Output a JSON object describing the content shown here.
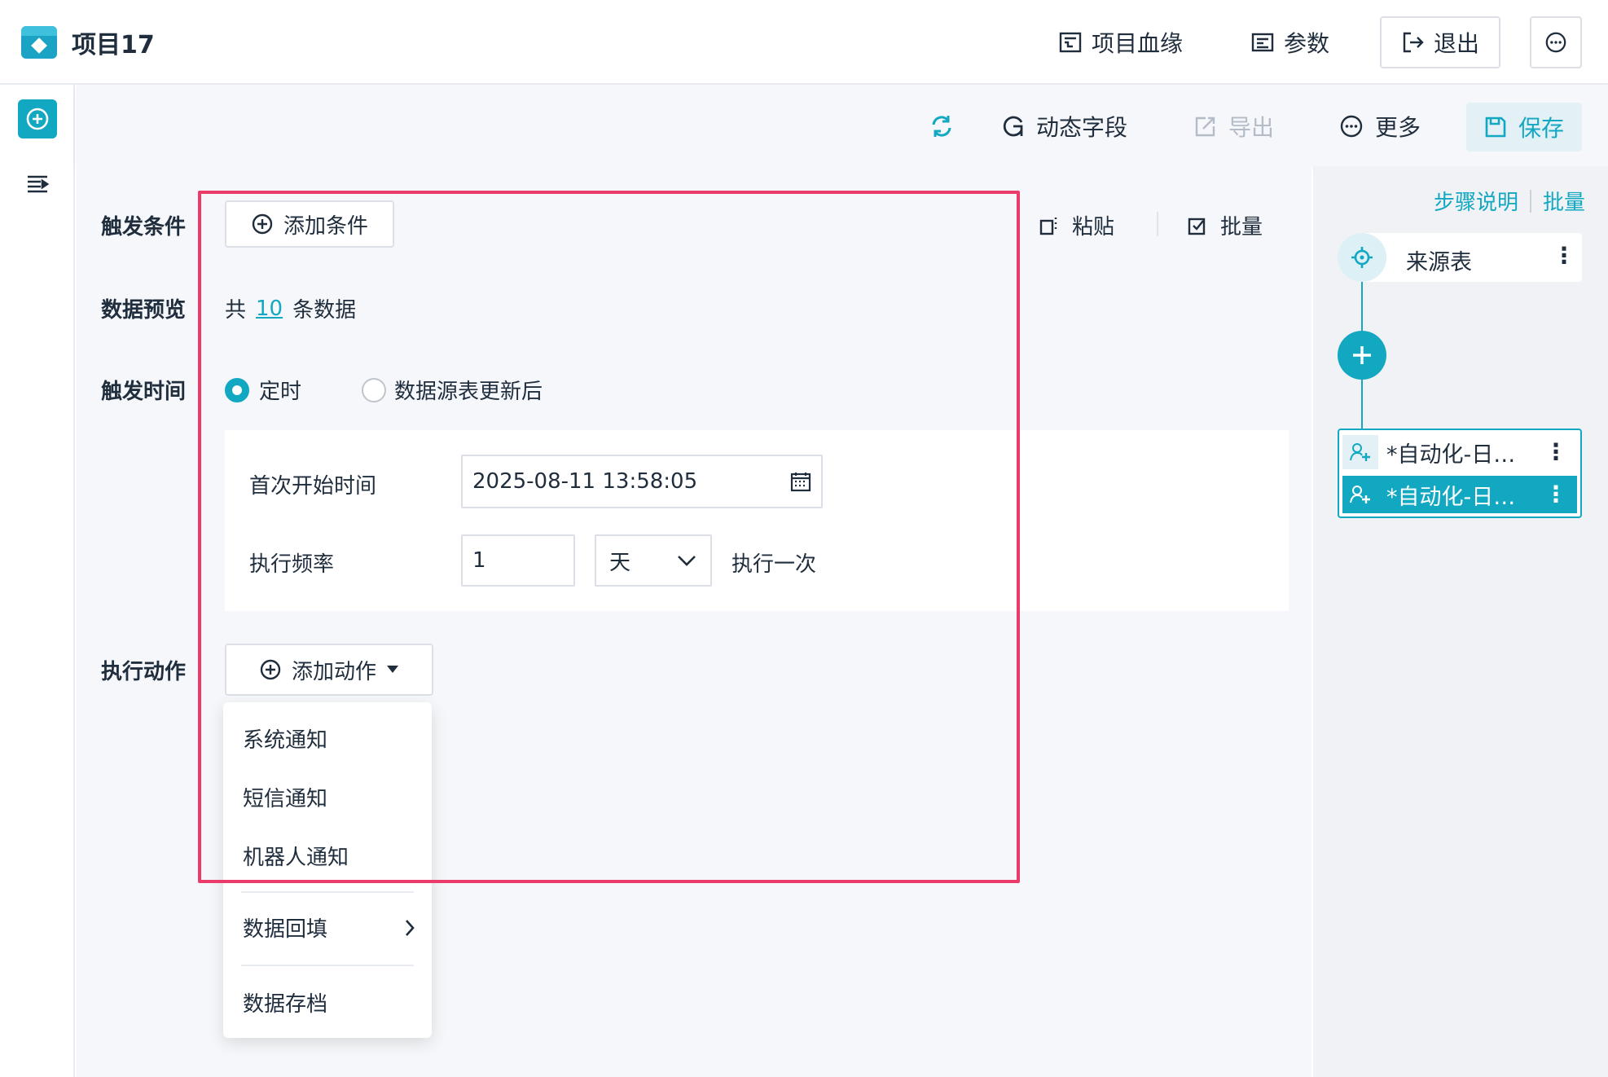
{
  "header": {
    "project_title": "项目17",
    "lineage_label": "项目血缘",
    "params_label": "参数",
    "exit_label": "退出"
  },
  "toolbar": {
    "dynamic_fields_label": "动态字段",
    "export_label": "导出",
    "more_label": "更多",
    "save_label": "保存"
  },
  "form": {
    "trigger_condition_label": "触发条件",
    "add_condition_label": "添加条件",
    "paste_label": "粘贴",
    "batch_label": "批量",
    "data_preview_label": "数据预览",
    "preview_prefix": "共",
    "preview_count": "10",
    "preview_suffix": "条数据",
    "trigger_time_label": "触发时间",
    "radio_timed_label": "定时",
    "radio_after_update_label": "数据源表更新后",
    "first_start_time_label": "首次开始时间",
    "first_start_time_value": "2025-08-11 13:58:05",
    "frequency_label": "执行频率",
    "frequency_value": "1",
    "frequency_unit": "天",
    "frequency_suffix": "执行一次",
    "action_label": "执行动作",
    "add_action_label": "添加动作"
  },
  "dropdown": {
    "items": [
      "系统通知",
      "短信通知",
      "机器人通知",
      "数据回填",
      "数据存档"
    ]
  },
  "flow": {
    "step_desc_link": "步骤说明",
    "batch_link": "批量",
    "source_node_label": "来源表",
    "steps": [
      "*自动化-日…",
      "*自动化-日…"
    ]
  },
  "colors": {
    "accent": "#13a8c2",
    "highlight": "#ea3b6b"
  },
  "icons": [
    "app-logo-icon",
    "lineage-icon",
    "params-icon",
    "exit-icon",
    "more-circle-icon",
    "refresh-icon",
    "dynamic-field-icon",
    "export-icon",
    "save-icon",
    "paste-icon",
    "batch-icon",
    "calendar-icon",
    "chevron-down-icon",
    "caret-down-icon",
    "chevron-right-icon",
    "crosshair-icon",
    "plus-icon",
    "automation-icon",
    "kebab-icon",
    "list-icon"
  ]
}
